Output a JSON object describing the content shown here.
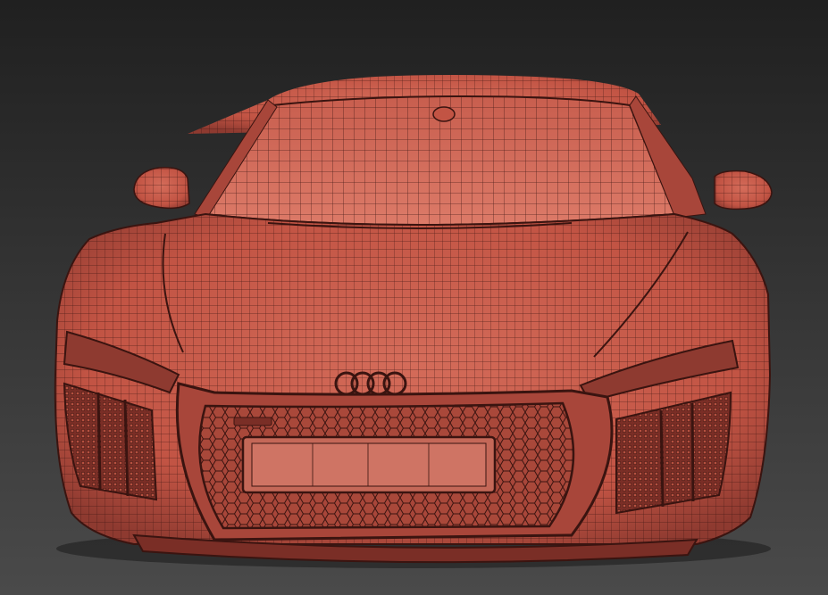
{
  "viewport": {
    "view": "front",
    "render_mode": "wireframe-on-shaded",
    "background_top": "#202020",
    "background_bottom": "#4a4a4a"
  },
  "model": {
    "subject": "sports-car",
    "body_color": "#c85a4a",
    "body_shadow_color": "#8e3a30",
    "glass_color": "#d06c5c",
    "wire_color": "#3a1410",
    "grille_color": "#6e2a22",
    "logo_icon": "four-rings-icon"
  }
}
